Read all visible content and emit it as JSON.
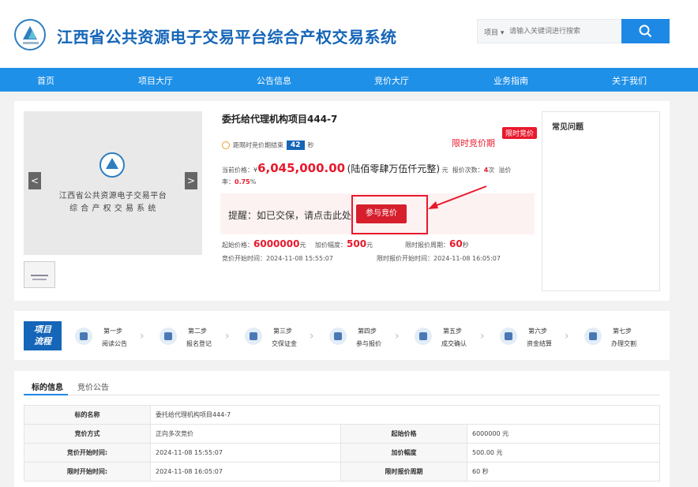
{
  "header": {
    "site_title": "江西省公共资源电子交易平台综合产权交易系统",
    "search_type": "项目",
    "search_placeholder": "请输入关键词进行搜索"
  },
  "nav": [
    "首页",
    "项目大厅",
    "公告信息",
    "竞价大厅",
    "业务指南",
    "关于我们"
  ],
  "gallery": {
    "line1": "江西省公共资源电子交易平台",
    "line2": "综 合 产 权 交 易 系 统",
    "prev": "<",
    "next": ">"
  },
  "project": {
    "title": "委托给代理机构项目444-7",
    "badge": "限时竞价",
    "stage": "限时竞价期",
    "countdown_label": "距限时竞价期结束",
    "countdown_value": "42",
    "countdown_unit": "秒",
    "current_price_label": "当前价格：¥",
    "current_price": "6,045,000.00",
    "current_price_cn": "(陆佰零肆万伍仟元整)",
    "price_unit": "元",
    "bid_count_label": "报价次数：",
    "bid_count": "4",
    "bid_count_unit": "次",
    "premium_label": "溢价",
    "premium_rate_label": "率：",
    "premium_rate": "0.75",
    "premium_unit": "%",
    "remind_text": "提醒：如已交保，请点击此处",
    "bid_button": "参与竞价",
    "start_price_label": "起始价格：",
    "start_price": "6000000",
    "start_price_unit": "元",
    "increment_label": "加价幅度：",
    "increment": "500",
    "increment_unit": "元",
    "period_label": "限时报价周期：",
    "period": "60",
    "period_unit": "秒",
    "bid_start_label": "竞价开始时间：",
    "bid_start": "2024-11-08 15:55:07",
    "limited_start_label": "限时报价开始时间：",
    "limited_start": "2024-11-08 16:05:07"
  },
  "faq": {
    "title": "常见问题"
  },
  "flow": {
    "badge_line1": "项目",
    "badge_line2": "流程",
    "steps": [
      {
        "num": "第一步",
        "label": "阅读公告"
      },
      {
        "num": "第二步",
        "label": "报名登记"
      },
      {
        "num": "第三步",
        "label": "交保证金"
      },
      {
        "num": "第四步",
        "label": "参与报价"
      },
      {
        "num": "第五步",
        "label": "成交确认"
      },
      {
        "num": "第六步",
        "label": "资金结算"
      },
      {
        "num": "第七步",
        "label": "办理交割"
      }
    ]
  },
  "tabs": [
    "标的信息",
    "竞价公告"
  ],
  "table": {
    "r1": {
      "l": "标的名称",
      "v": "委托给代理机构项目444-7"
    },
    "r2": {
      "l1": "竞价方式",
      "v1": "正向多次竞价",
      "l2": "起始价格",
      "v2": "6000000 元"
    },
    "r3": {
      "l1": "竞价开始时间:",
      "v1": "2024-11-08 15:55:07",
      "l2": "加价幅度",
      "v2": "500.00 元"
    },
    "r4": {
      "l1": "限时开始时间:",
      "v1": "2024-11-08 16:05:07",
      "l2": "限时报价周期",
      "v2": "60 秒"
    }
  }
}
